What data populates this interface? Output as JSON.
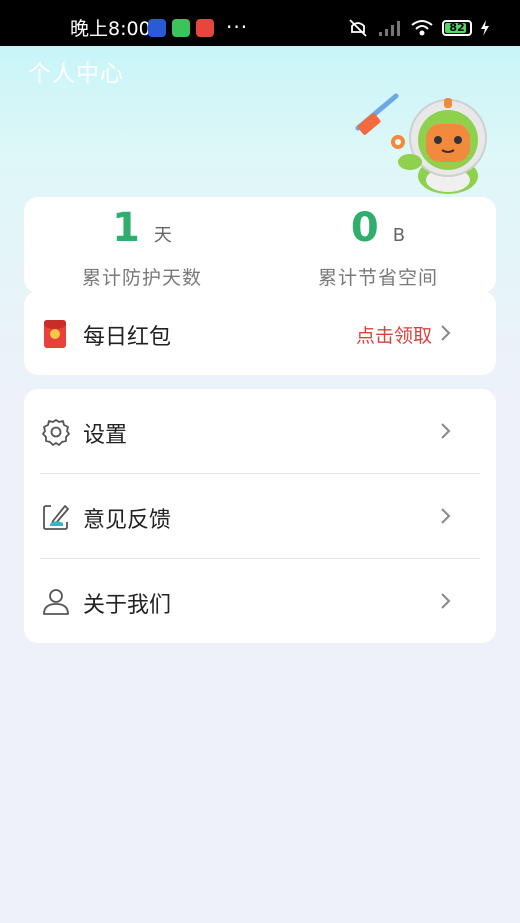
{
  "status_bar": {
    "time": "晚上8:00",
    "more": "···",
    "battery": "82"
  },
  "page": {
    "title": "个人中心"
  },
  "stats": [
    {
      "value": "1",
      "unit": "天",
      "label": "累计防护天数"
    },
    {
      "value": "0",
      "unit": "B",
      "label": "累计节省空间"
    }
  ],
  "red_packet": {
    "title": "每日红包",
    "action": "点击领取"
  },
  "menu": [
    {
      "label": "设置",
      "icon": "gear-icon"
    },
    {
      "label": "意见反馈",
      "icon": "feedback-icon"
    },
    {
      "label": "关于我们",
      "icon": "person-icon"
    }
  ],
  "colors": {
    "accent_green": "#2fae6e",
    "action_red": "#d9423c",
    "background": "#eef1fa"
  }
}
